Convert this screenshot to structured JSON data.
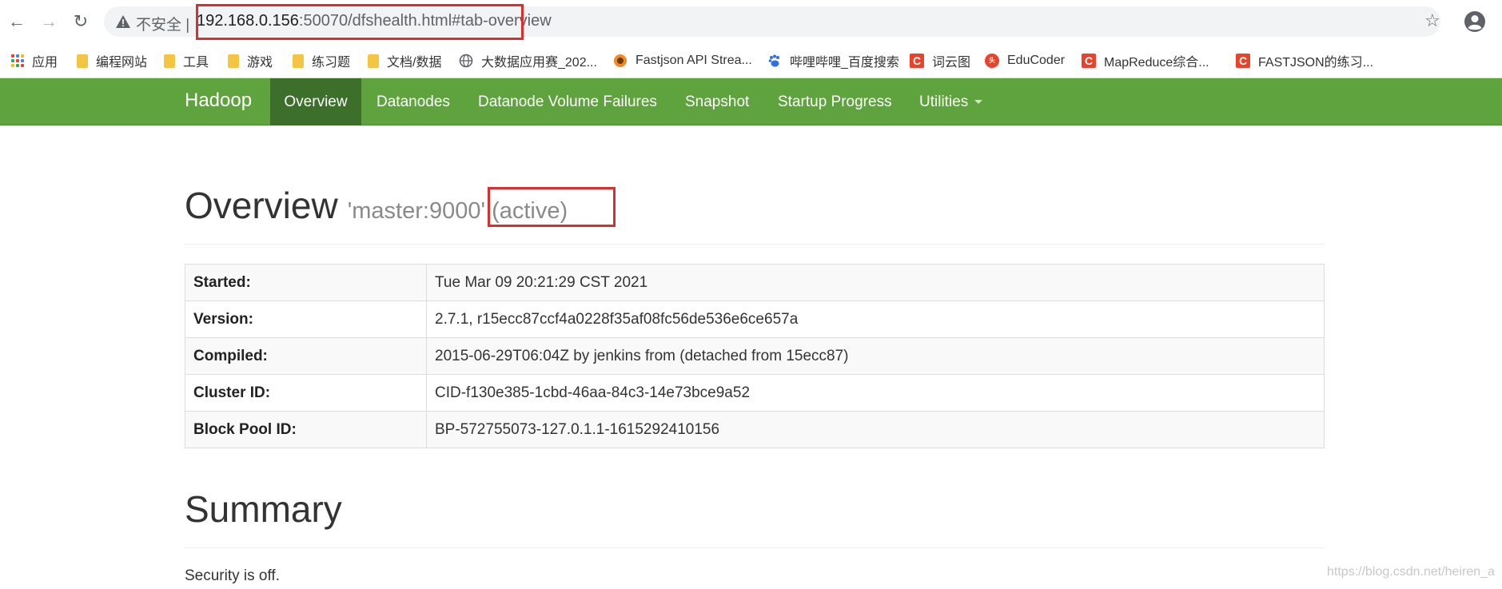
{
  "browser": {
    "insecure_label": "不安全 |",
    "url_host": "192.168.0.156",
    "url_rest": ":50070/dfshealth.html#tab-overview",
    "icons": [
      "back-icon",
      "forward-icon",
      "reload-icon",
      "warning-icon",
      "star-icon",
      "account-icon"
    ]
  },
  "bookmarks": [
    {
      "label": "应用",
      "icon": "apps-icon"
    },
    {
      "label": "编程网站",
      "icon": "folder-icon"
    },
    {
      "label": "工具",
      "icon": "folder-icon"
    },
    {
      "label": "游戏",
      "icon": "folder-icon"
    },
    {
      "label": "练习题",
      "icon": "folder-icon"
    },
    {
      "label": "文档/数据",
      "icon": "folder-icon"
    },
    {
      "label": "大数据应用赛_202...",
      "icon": "globe-icon"
    },
    {
      "label": "Fastjson API Strea...",
      "icon": "site-icon"
    },
    {
      "label": "哔哩哔哩_百度搜索",
      "icon": "baidu-paw-icon"
    },
    {
      "label": "词云图",
      "icon": "csdn-icon"
    },
    {
      "label": "EduCoder",
      "icon": "educoder-icon"
    },
    {
      "label": "MapReduce综合...",
      "icon": "csdn-icon"
    },
    {
      "label": "FASTJSON的练习...",
      "icon": "csdn-icon"
    }
  ],
  "navbar": {
    "brand": "Hadoop",
    "links": [
      "Overview",
      "Datanodes",
      "Datanode Volume Failures",
      "Snapshot",
      "Startup Progress",
      "Utilities"
    ],
    "active": "Overview",
    "color": "#5fa33e"
  },
  "overview": {
    "title": "Overview",
    "subtitle": "'master:9000'",
    "state": "(active)",
    "rows": [
      {
        "key": "Started:",
        "value": "Tue Mar 09 20:21:29 CST 2021"
      },
      {
        "key": "Version:",
        "value": "2.7.1, r15ecc87ccf4a0228f35af08fc56de536e6ce657a"
      },
      {
        "key": "Compiled:",
        "value": "2015-06-29T06:04Z by jenkins from (detached from 15ecc87)"
      },
      {
        "key": "Cluster ID:",
        "value": "CID-f130e385-1cbd-46aa-84c3-14e73bce9a52"
      },
      {
        "key": "Block Pool ID:",
        "value": "BP-572755073-127.0.1.1-1615292410156"
      }
    ]
  },
  "summary": {
    "title": "Summary",
    "security": "Security is off."
  },
  "watermark": "https://blog.csdn.net/heiren_a",
  "highlight_color": "#d9302e"
}
